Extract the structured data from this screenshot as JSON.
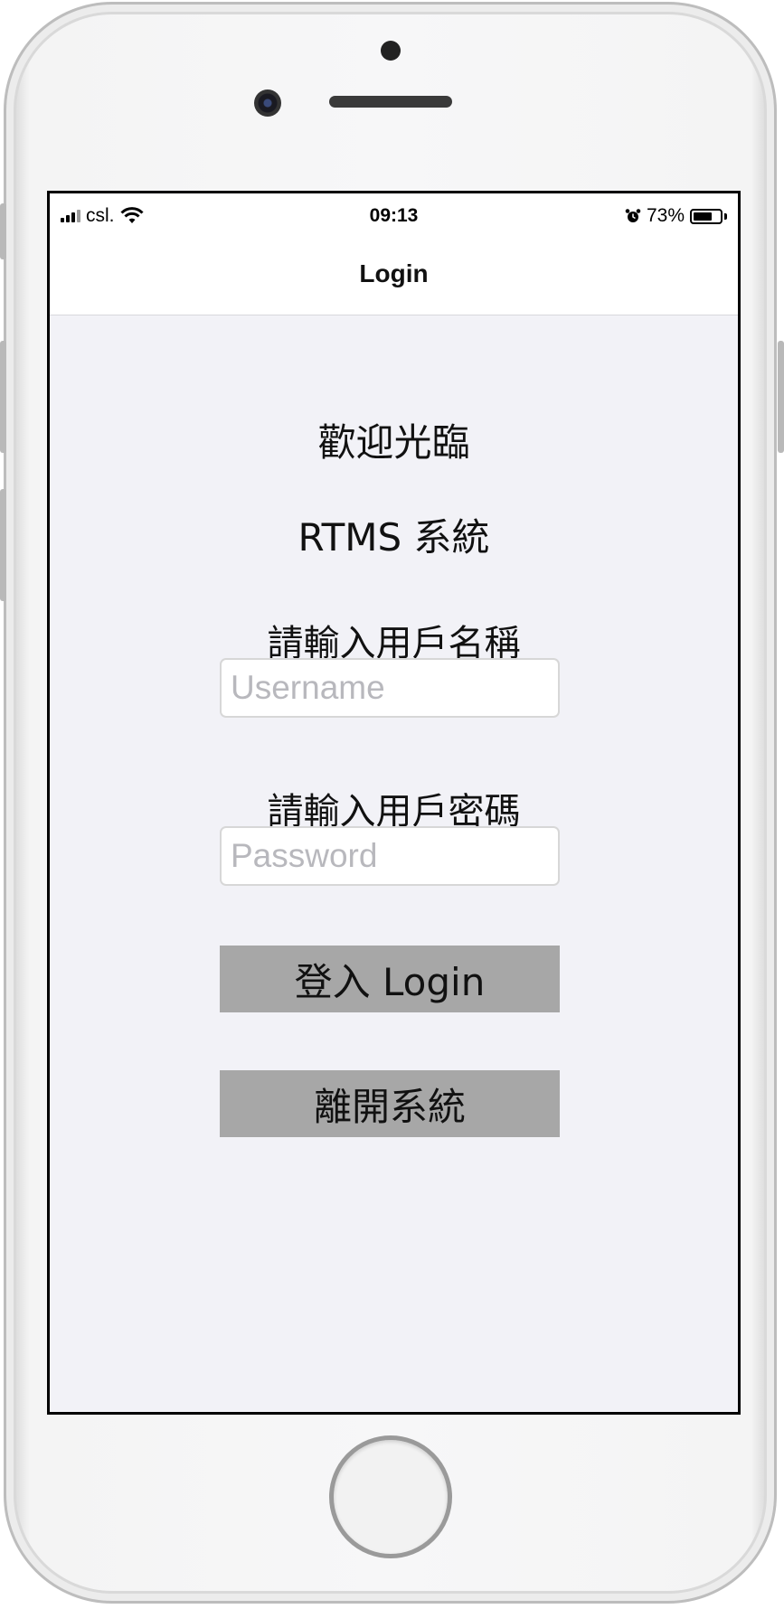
{
  "status_bar": {
    "carrier": "csl.",
    "time": "09:13",
    "battery_percent": "73%",
    "battery_level": 0.73,
    "icons": [
      "signal-icon",
      "wifi-icon",
      "alarm-icon",
      "battery-icon"
    ]
  },
  "nav": {
    "title": "Login"
  },
  "main": {
    "welcome": "歡迎光臨",
    "system_name": "RTMS 系統",
    "username_label": "請輸入用戶名稱",
    "username_placeholder": "Username",
    "username_value": "",
    "password_label": "請輸入用戶密碼",
    "password_placeholder": "Password",
    "password_value": "",
    "login_button": "登入 Login",
    "exit_button": "離開系統"
  },
  "colors": {
    "screen_background": "#f2f2f7",
    "button_background": "#a7a7a7",
    "placeholder": "#b8b8bd"
  }
}
